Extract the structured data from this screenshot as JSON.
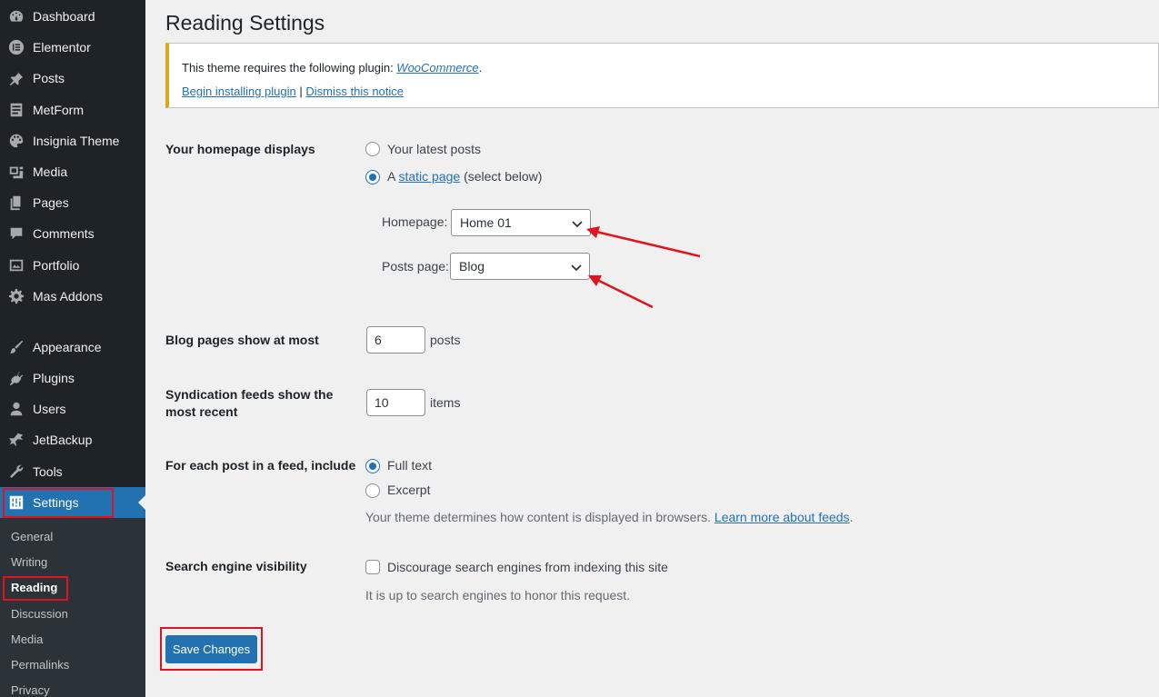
{
  "sidebar": {
    "items": [
      {
        "label": "Dashboard",
        "icon": "dashboard-icon"
      },
      {
        "label": "Elementor",
        "icon": "elementor-icon"
      },
      {
        "label": "Posts",
        "icon": "pin-icon"
      },
      {
        "label": "MetForm",
        "icon": "form-icon"
      },
      {
        "label": "Insignia Theme",
        "icon": "palette-icon"
      },
      {
        "label": "Media",
        "icon": "media-icon"
      },
      {
        "label": "Pages",
        "icon": "pages-icon"
      },
      {
        "label": "Comments",
        "icon": "comment-icon"
      },
      {
        "label": "Portfolio",
        "icon": "portfolio-icon"
      },
      {
        "label": "Mas Addons",
        "icon": "gear-icon"
      },
      {
        "label": "Appearance",
        "icon": "brush-icon"
      },
      {
        "label": "Plugins",
        "icon": "plugin-icon"
      },
      {
        "label": "Users",
        "icon": "user-icon"
      },
      {
        "label": "JetBackup",
        "icon": "jetbackup-icon"
      },
      {
        "label": "Tools",
        "icon": "wrench-icon"
      },
      {
        "label": "Settings",
        "icon": "settings-sliders-icon"
      }
    ],
    "submenu": [
      "General",
      "Writing",
      "Reading",
      "Discussion",
      "Media",
      "Permalinks",
      "Privacy"
    ]
  },
  "page": {
    "title": "Reading Settings"
  },
  "notice": {
    "text_prefix": "This theme requires the following plugin: ",
    "plugin_link": "WooCommerce",
    "text_suffix": ".",
    "install_link": "Begin installing plugin",
    "separator": " | ",
    "dismiss_link": "Dismiss this notice"
  },
  "form": {
    "homepage_displays": {
      "label": "Your homepage displays",
      "option_latest": "Your latest posts",
      "option_static_prefix": "A ",
      "option_static_link": "static page",
      "option_static_suffix": " (select below)",
      "selected": "static page",
      "homepage_label": "Homepage:",
      "homepage_value": "Home 01",
      "posts_page_label": "Posts page:",
      "posts_page_value": "Blog"
    },
    "blog_pages": {
      "label": "Blog pages show at most",
      "value": "6",
      "unit": "posts"
    },
    "syndication": {
      "label_line1": "Syndication feeds show the",
      "label_line2": "most recent",
      "value": "10",
      "unit": "items"
    },
    "feed_include": {
      "label": "For each post in a feed, include",
      "option_full": "Full text",
      "option_excerpt": "Excerpt",
      "selected": "Full text",
      "description": "Your theme determines how content is displayed in browsers. ",
      "learn_more": "Learn more about feeds",
      "description_end": "."
    },
    "search_visibility": {
      "label": "Search engine visibility",
      "checkbox_label": "Discourage search engines from indexing this site",
      "checked": false,
      "description": "It is up to search engines to honor this request."
    },
    "save_button": "Save Changes"
  },
  "colors": {
    "accent": "#2271b1",
    "sidebar": "#1d2327",
    "highlight": "#e0141e",
    "notice_border": "#dba617"
  }
}
